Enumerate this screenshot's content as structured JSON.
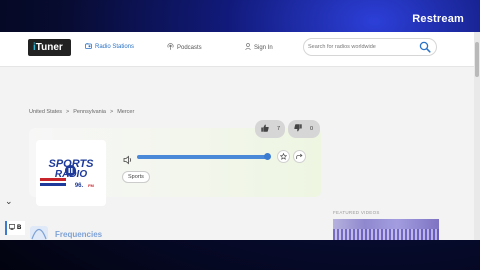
{
  "overlay": {
    "brand": "Restream"
  },
  "nav": {
    "logo": {
      "prefix": "i",
      "rest": "Tuner"
    },
    "items": [
      {
        "label": "Radio Stations",
        "icon": "radio-icon",
        "active": true
      },
      {
        "label": "Podcasts",
        "icon": "podcast-icon",
        "active": false
      },
      {
        "label": "Sign In",
        "icon": "user-icon",
        "active": false
      }
    ],
    "search": {
      "placeholder": "Search for radios worldwide",
      "value": "",
      "icon": "search-icon"
    }
  },
  "breadcrumb": {
    "items": [
      "United States",
      "Pennsylvania",
      "Mercer"
    ],
    "separator": ">"
  },
  "station": {
    "logo": {
      "line1": "SPORTS",
      "line2": "RADIO",
      "freq": "96.",
      "unit": "FM",
      "icon": "pause-icon"
    },
    "likes": "7",
    "dislikes": "0",
    "volume": 1.0,
    "tag": "Sports",
    "accent": "#3b7bd0"
  },
  "sidebar": {
    "item_label": "B",
    "icon": "monitor-icon"
  },
  "section": {
    "title": "Frequencies",
    "icon": "frequency-icon"
  },
  "featured": {
    "label": "FEATURED VIDEOS"
  }
}
